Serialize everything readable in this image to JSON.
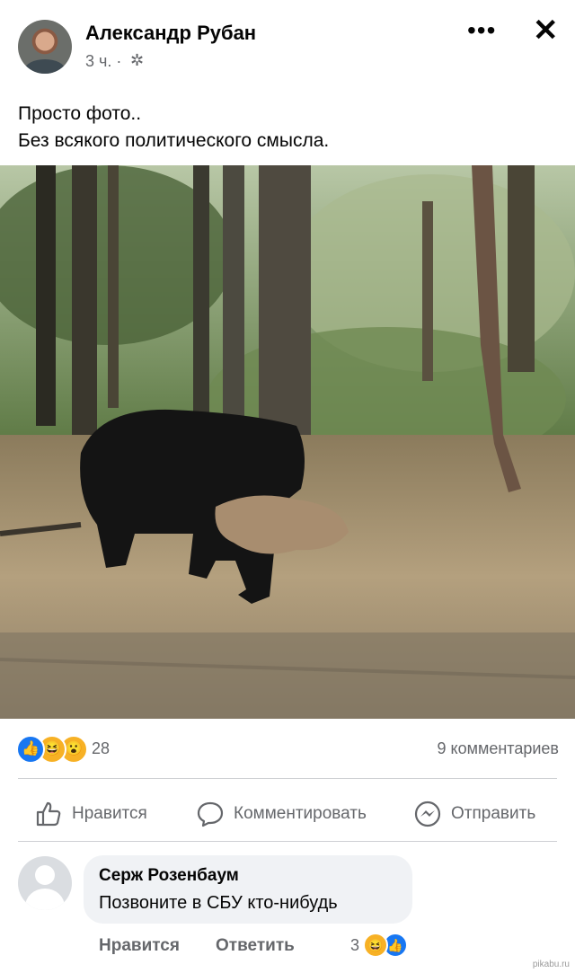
{
  "post": {
    "author": "Александр Рубан",
    "time": "3 ч. ·",
    "privacy_icon": "gear-icon",
    "text_line1": "Просто фото..",
    "text_line2": "Без всякого политического смысла."
  },
  "header_controls": {
    "more_label": "•••",
    "close_label": "✕"
  },
  "reactions": {
    "icons": [
      "like",
      "haha",
      "wow"
    ],
    "count": "28",
    "comments_count": "9 комментариев"
  },
  "actions": {
    "like": "Нравится",
    "comment": "Комментировать",
    "share": "Отправить"
  },
  "comment": {
    "author": "Серж Розенбаум",
    "text": "Позвоните в СБУ кто-нибудь",
    "like": "Нравится",
    "reply": "Ответить",
    "reaction_count": "3",
    "reaction_icons": [
      "haha",
      "like"
    ]
  },
  "watermark": "pikabu.ru",
  "colors": {
    "accent": "#1877f2",
    "text_secondary": "#65676b",
    "divider": "#ced0d4"
  }
}
